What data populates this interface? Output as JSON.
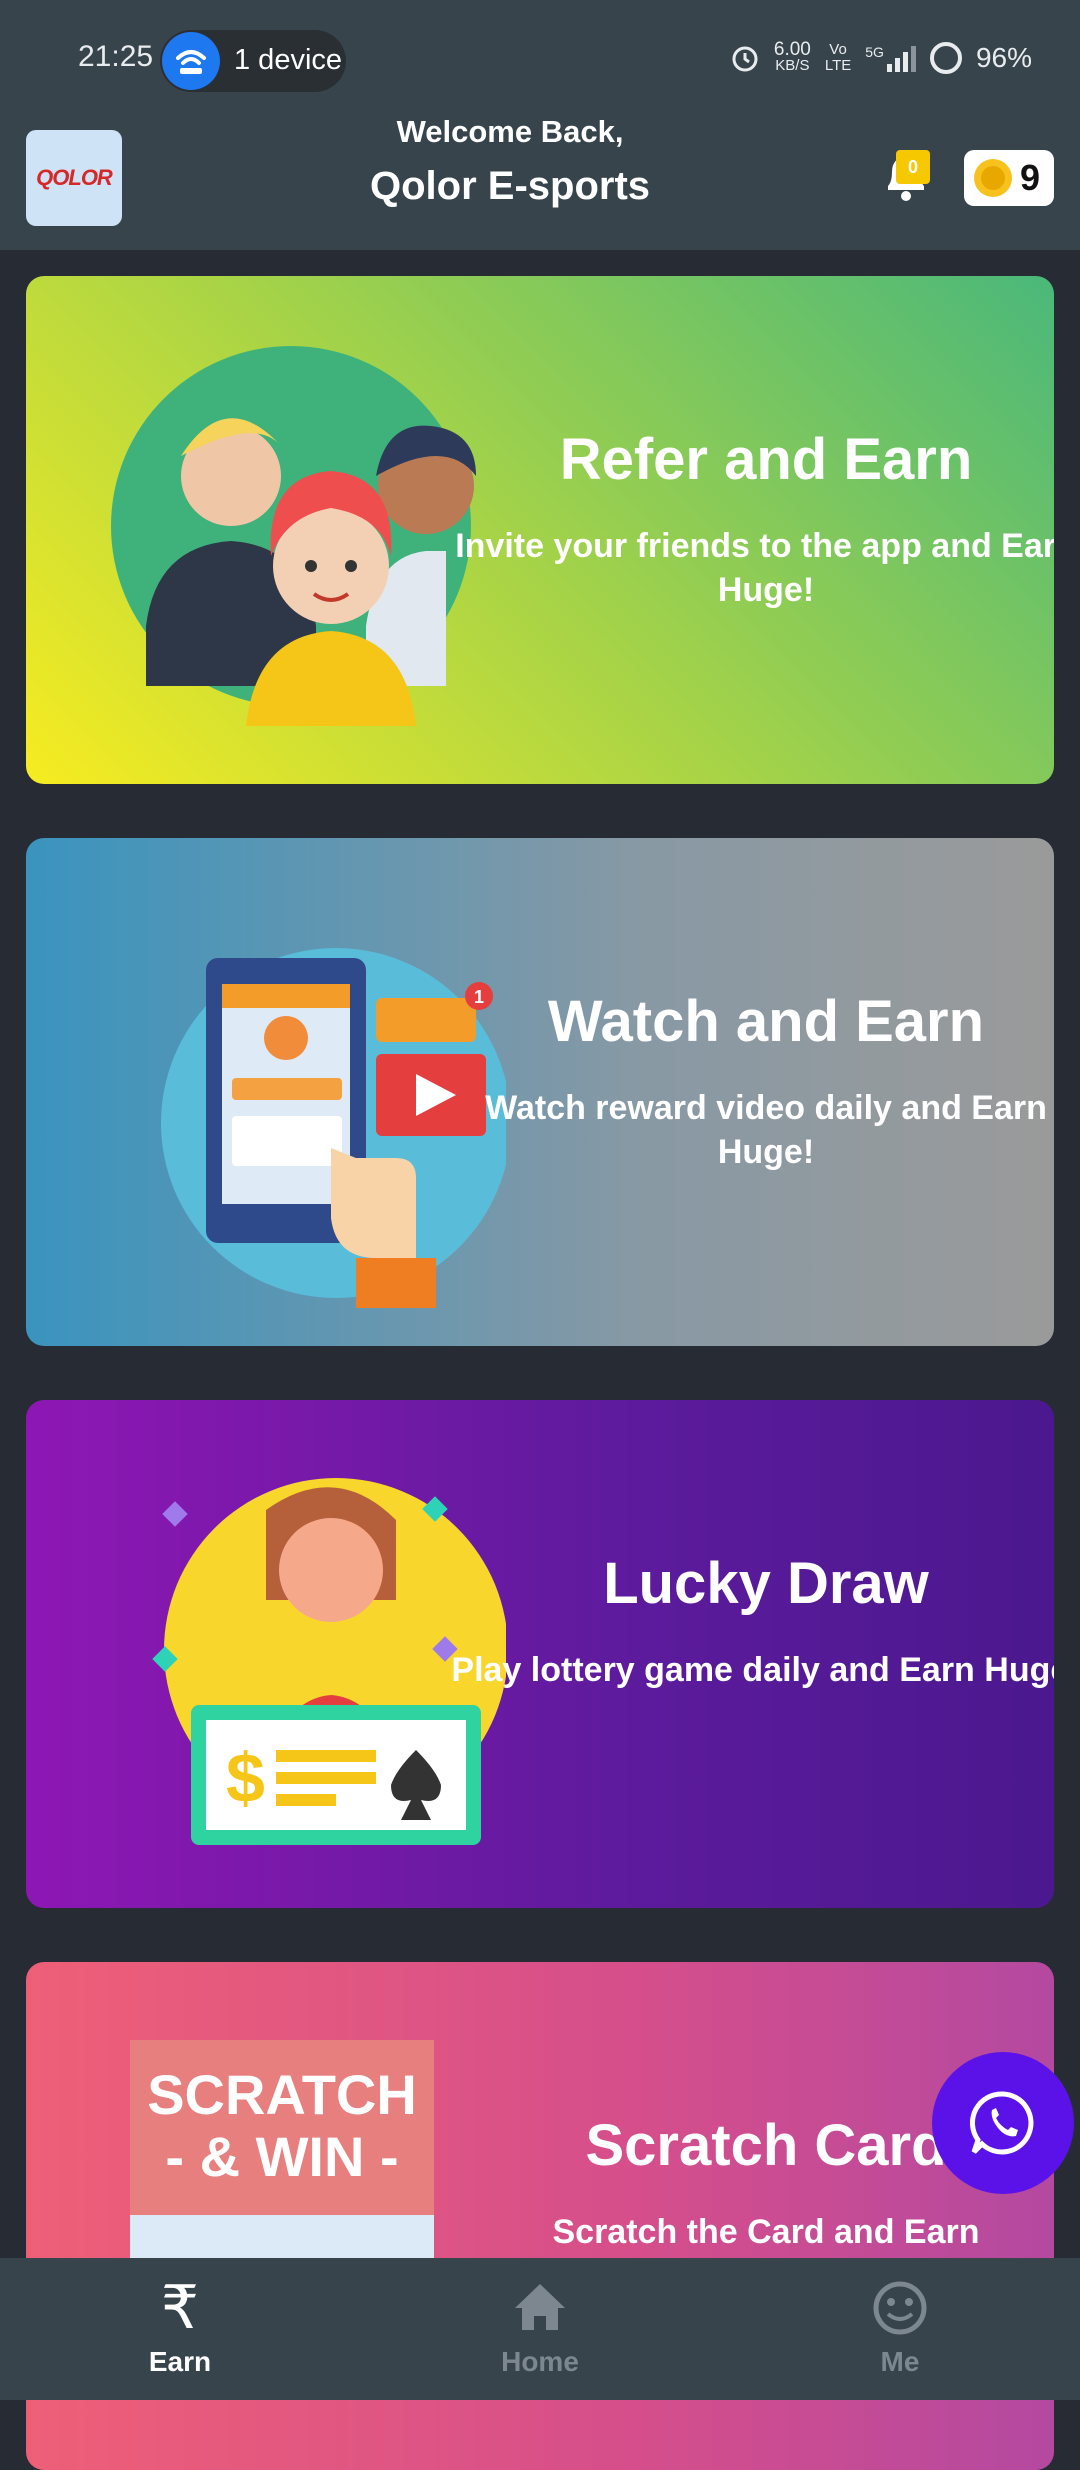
{
  "status_bar": {
    "time": "21:25",
    "hotspot": "1 device",
    "speed_value": "6.00",
    "speed_unit": "KB/S",
    "volte_top": "Vo",
    "volte_bottom": "LTE",
    "network": "5G",
    "battery": "96%"
  },
  "header": {
    "logo_text": "QOLOR",
    "welcome": "Welcome Back,",
    "username": "Qolor E-sports",
    "notification_count": "0",
    "coin_balance": "9"
  },
  "cards": [
    {
      "title": "Refer and Earn",
      "description": "Invite your friends to the app and Earn Huge!"
    },
    {
      "title": "Watch and Earn",
      "description": "Watch reward video daily and Earn Huge!",
      "badge": "1"
    },
    {
      "title": "Lucky Draw",
      "description": "Play lottery game daily and Earn Huge!"
    },
    {
      "title": "Scratch Card",
      "description": "Scratch the Card and Earn",
      "image_text_1": "SCRATCH",
      "image_text_2": "- & WIN -"
    }
  ],
  "bottom_nav": [
    {
      "label": "Earn",
      "icon": "rupee-icon",
      "active": true
    },
    {
      "label": "Home",
      "icon": "home-icon",
      "active": false
    },
    {
      "label": "Me",
      "icon": "smiley-icon",
      "active": false
    }
  ],
  "colors": {
    "header_bg": "#37444c",
    "page_bg": "#272b34",
    "fab": "#5b12e8",
    "badge": "#f6c800"
  }
}
